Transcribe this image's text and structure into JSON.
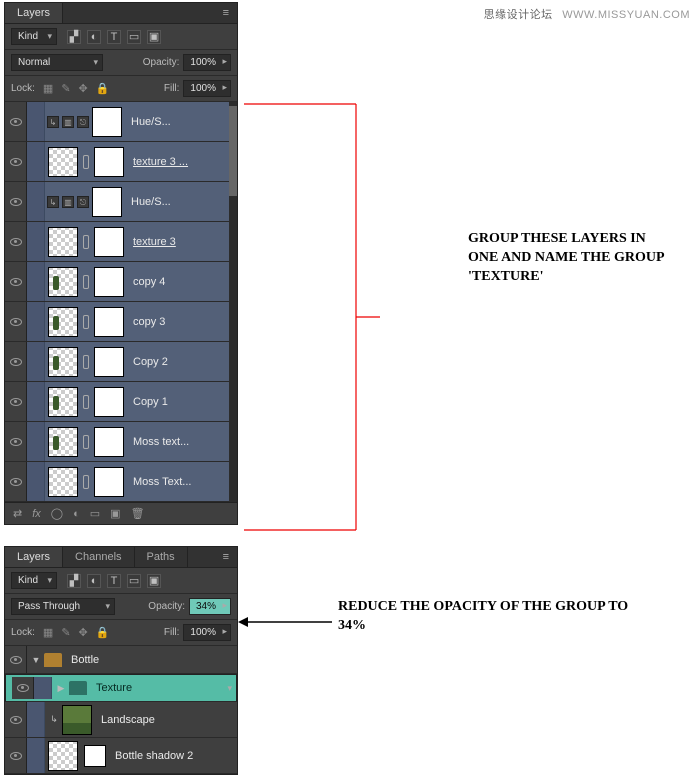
{
  "watermark": {
    "cn": "思缘设计论坛",
    "en": "WWW.MISSYUAN.COM"
  },
  "panelTop": {
    "tab": "Layers",
    "filter": {
      "kind": "Kind"
    },
    "blend": {
      "mode": "Normal",
      "opacityLabel": "Opacity:",
      "opacity": "100%"
    },
    "lock": {
      "label": "Lock:",
      "fillLabel": "Fill:",
      "fill": "100%"
    },
    "layers": [
      {
        "name": "Hue/S...",
        "underline": false,
        "checker": false,
        "adj": true
      },
      {
        "name": "texture 3 ...",
        "underline": true,
        "checker": true,
        "adj": false
      },
      {
        "name": "Hue/S...",
        "underline": false,
        "checker": false,
        "adj": true
      },
      {
        "name": "texture 3",
        "underline": true,
        "checker": true,
        "adj": false
      },
      {
        "name": "copy 4",
        "underline": false,
        "checker": true,
        "adj": false
      },
      {
        "name": "copy 3",
        "underline": false,
        "checker": true,
        "adj": false
      },
      {
        "name": "Copy 2",
        "underline": false,
        "checker": true,
        "adj": false
      },
      {
        "name": "Copy 1",
        "underline": false,
        "checker": true,
        "adj": false
      },
      {
        "name": "Moss text...",
        "underline": false,
        "checker": true,
        "adj": false
      },
      {
        "name": "Moss Text...",
        "underline": false,
        "checker": true,
        "adj": false
      }
    ]
  },
  "panelBottom": {
    "tabs": [
      "Layers",
      "Channels",
      "Paths"
    ],
    "activeTab": "Layers",
    "filter": {
      "kind": "Kind"
    },
    "blend": {
      "mode": "Pass Through",
      "opacityLabel": "Opacity:",
      "opacity": "34%"
    },
    "lock": {
      "label": "Lock:",
      "fillLabel": "Fill:",
      "fill": "100%"
    },
    "layers": {
      "bottle": "Bottle",
      "texture": "Texture",
      "landscape": "Landscape",
      "bottleShadow": "Bottle shadow 2"
    }
  },
  "annotation1": "GROUP THESE LAYERS IN ONE AND NAME THE GROUP 'TEXTURE'",
  "annotation2": "REDUCE THE OPACITY OF THE GROUP TO 34%"
}
